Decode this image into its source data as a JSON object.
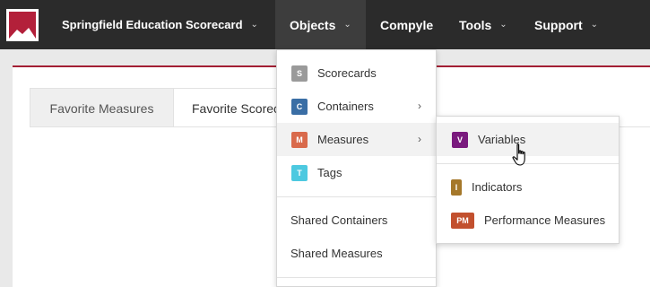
{
  "navbar": {
    "org_label": "Springfield Education Scorecard",
    "objects_label": "Objects",
    "compyle_label": "Compyle",
    "tools_label": "Tools",
    "support_label": "Support",
    "chevron": "⌄"
  },
  "tabs": [
    {
      "label": "Favorite Measures"
    },
    {
      "label": "Favorite Scorec"
    }
  ],
  "objects_menu": {
    "items": [
      {
        "badge": "S",
        "badge_color": "#9a9a9a",
        "label": "Scorecards"
      },
      {
        "badge": "C",
        "badge_color": "#3a6ea5",
        "label": "Containers",
        "submenu_arrow": "›"
      },
      {
        "badge": "M",
        "badge_color": "#d96a4c",
        "label": "Measures",
        "submenu_arrow": "›"
      },
      {
        "badge": "T",
        "badge_color": "#4dc9e0",
        "label": "Tags"
      }
    ],
    "links": [
      {
        "label": "Shared Containers"
      },
      {
        "label": "Shared Measures"
      }
    ]
  },
  "measures_menu": {
    "items": [
      {
        "badge": "V",
        "badge_color": "#7a1a7e",
        "label": "Variables"
      },
      {
        "badge": "I",
        "badge_color": "#a5782a",
        "label": "Indicators"
      },
      {
        "badge": "PM",
        "badge_color": "#c2502e",
        "label": "Performance Measures"
      }
    ]
  },
  "colors": {
    "navbar": "#2b2b2b",
    "accent": "#a31f34"
  }
}
